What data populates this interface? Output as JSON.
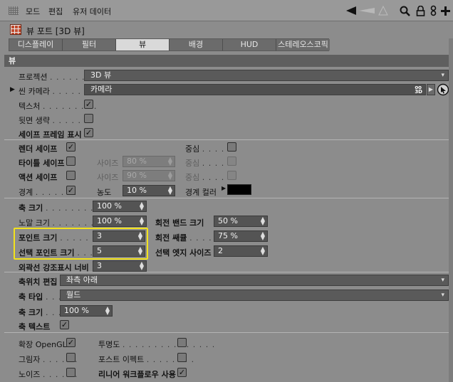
{
  "menubar": {
    "items": [
      "모드",
      "편집",
      "유저 데이터"
    ]
  },
  "toolbar_icons": [
    "arrow-back-icon",
    "search-icon",
    "lock-icon",
    "link-icon",
    "add-icon"
  ],
  "header": {
    "title": "뷰 포트 [3D 뷰]"
  },
  "tabs": [
    {
      "label": "디스플레이",
      "active": false
    },
    {
      "label": "필터",
      "active": false
    },
    {
      "label": "뷰",
      "active": true
    },
    {
      "label": "배경",
      "active": false
    },
    {
      "label": "HUD",
      "active": false
    },
    {
      "label": "스테레오스코픽",
      "active": false
    }
  ],
  "section": {
    "title": "뷰"
  },
  "fields": {
    "projection": {
      "label": "프로젝션",
      "value": "3D 뷰"
    },
    "scene_camera": {
      "label": "씬 카메라",
      "value": "카메라"
    },
    "texture": {
      "label": "텍스처",
      "checked": true
    },
    "backface": {
      "label": "뒷면 생략",
      "checked": false
    },
    "safe_frame": {
      "label": "세이프 프레임 표시",
      "checked": true
    },
    "render_safe": {
      "label": "렌더 세이프",
      "checked": true
    },
    "render_center": {
      "label": "중심",
      "checked": false
    },
    "title_safe": {
      "label": "타이틀 세이프",
      "checked": false
    },
    "title_size": {
      "label": "사이즈",
      "value": "80 %"
    },
    "title_center": {
      "label": "중심",
      "checked": false
    },
    "action_safe": {
      "label": "액션 세이프",
      "checked": false
    },
    "action_size": {
      "label": "사이즈",
      "value": "90 %"
    },
    "action_center": {
      "label": "중심",
      "checked": false
    },
    "border": {
      "label": "경계",
      "checked": true
    },
    "density": {
      "label": "농도",
      "value": "10 %"
    },
    "border_color": {
      "label": "경계 컬러",
      "value": "#000000"
    },
    "axis_size": {
      "label": "축 크기",
      "value": "100 %"
    },
    "normal_size": {
      "label": "노말 크기",
      "value": "100 %"
    },
    "rotation_band_size": {
      "label": "회전 밴드 크기",
      "value": "50 %"
    },
    "point_size": {
      "label": "포인트 크기",
      "value": "3"
    },
    "rotation_sugar": {
      "label": "회전 쌔큘",
      "value": "75 %"
    },
    "selected_point_size": {
      "label": "선택 포인트 크기",
      "value": "5"
    },
    "selected_edge_size": {
      "label": "선택 엣지 사이즈",
      "value": "2"
    },
    "outline_width": {
      "label": "외곽선 강조표시 너비",
      "value": "3"
    },
    "axis_position": {
      "label": "축위치 편집",
      "value": "좌측 아래"
    },
    "axis_type": {
      "label": "축 타입",
      "value": "월드"
    },
    "axis_size2": {
      "label": "축 크기",
      "value": "100 %"
    },
    "axis_text": {
      "label": "축 텍스트",
      "checked": true
    },
    "extended_opengl": {
      "label": "확장 OpenGL",
      "checked": true
    },
    "transparency": {
      "label": "투명도",
      "checked": false
    },
    "shadow": {
      "label": "그림자",
      "checked": false
    },
    "post_effect": {
      "label": "포스트 이펙트",
      "checked": false
    },
    "noise": {
      "label": "노이즈",
      "checked": false
    },
    "linear_workflow": {
      "label": "리니어 워크플로우 사용",
      "checked": true
    }
  },
  "highlight_color": "#f2e21c"
}
